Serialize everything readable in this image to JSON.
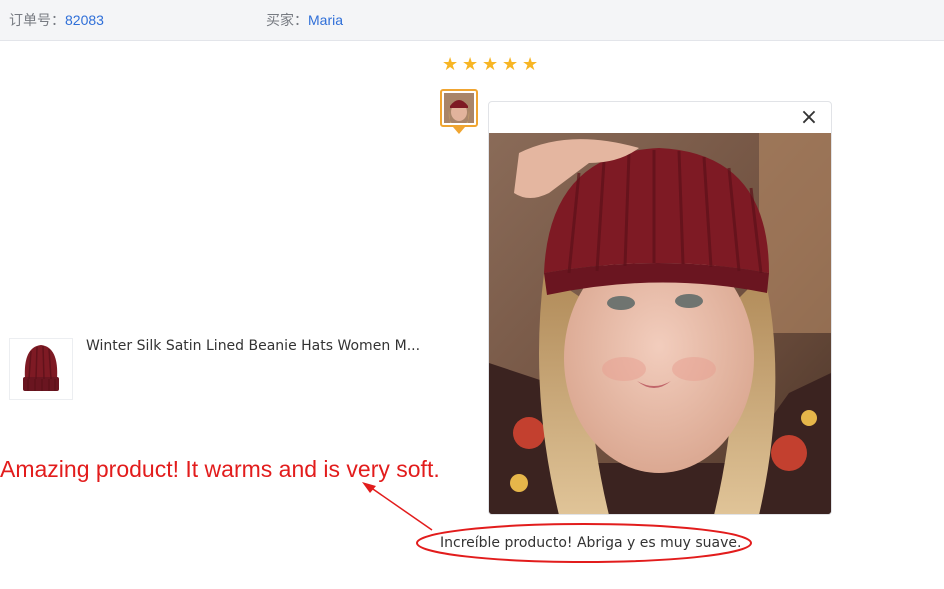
{
  "header": {
    "order_label": "订单号：",
    "order_value": "82083",
    "buyer_label": "买家：",
    "buyer_value": "Maria"
  },
  "review": {
    "rating": 5,
    "rating_max": 5,
    "text": "Increíble producto! Abriga y es muy suave."
  },
  "product": {
    "title": "Winter Silk Satin Lined Beanie Hats Women M..."
  },
  "annotation": {
    "text": "Amazing product! It warms and is very soft."
  },
  "icons": {
    "star": "star-icon",
    "close": "close-icon"
  },
  "colors": {
    "accent_link": "#2f6fd8",
    "star": "#f7b524",
    "thumb_border": "#f0a531",
    "annotation_red": "#e21c1c",
    "hat": "#7e1a24"
  }
}
